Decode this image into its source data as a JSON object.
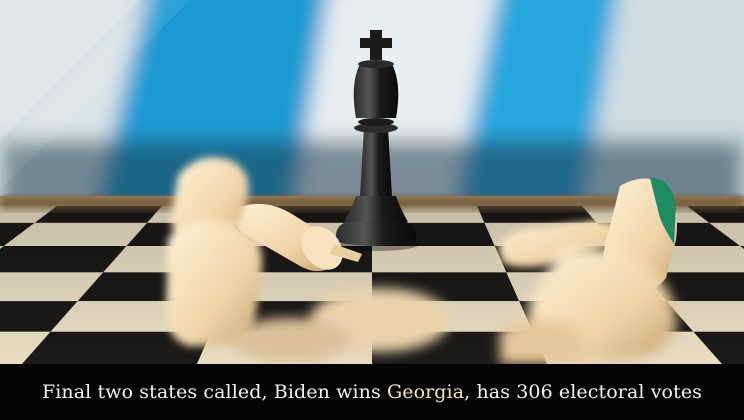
{
  "caption": {
    "before": "Final two states called, Biden wins ",
    "highlight": "Georgia",
    "after": ", has 306 electoral votes"
  },
  "colors": {
    "highlight": "#f3e6b4",
    "caption_text": "#f4f4f4",
    "caption_bg": "#050505",
    "flag_blue": "#2aa7d6",
    "flag_white": "#eef3f6",
    "board_dark": "#1b1917",
    "board_light": "#e8dcc2",
    "king": "#141414",
    "fallen_pieces": "#f2dcb4"
  },
  "image": {
    "subject": "black-king-standing-among-fallen-white-pieces"
  }
}
